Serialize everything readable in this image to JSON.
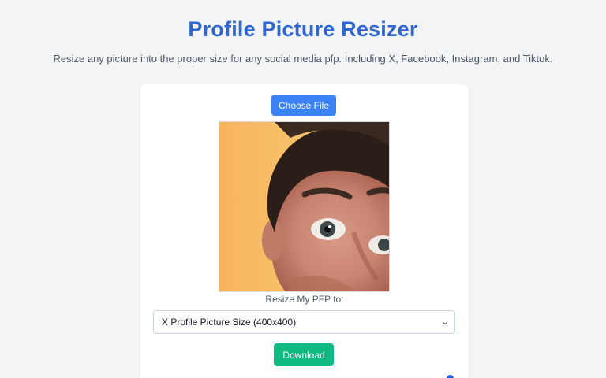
{
  "header": {
    "title": "Profile Picture Resizer",
    "subtitle": "Resize any picture into the proper size for any social media pfp. Including X, Facebook, Instagram, and Tiktok."
  },
  "uploader": {
    "choose_file_label": "Choose File",
    "preview_alt": "Uploaded profile picture preview"
  },
  "resize": {
    "label": "Resize My PFP to:",
    "selected_option": "X Profile Picture Size (400x400)"
  },
  "actions": {
    "download_label": "Download"
  },
  "colors": {
    "title": "#2f66d0",
    "choose_button": "#3b82f6",
    "download_button": "#10b981",
    "background": "#f3f4f6"
  },
  "icons": {
    "select_chevron": "chevron-down-icon"
  }
}
